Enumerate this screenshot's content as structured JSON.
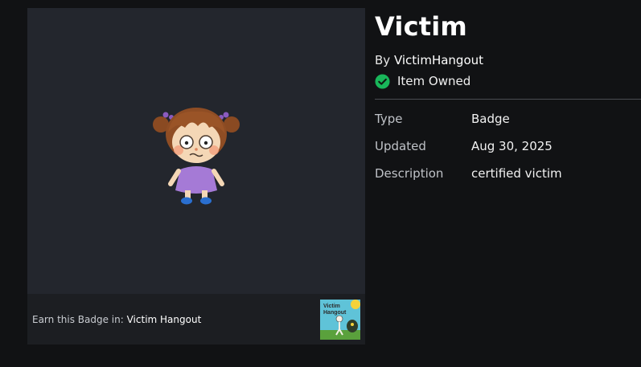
{
  "badge": {
    "title": "Victim",
    "creator_prefix": "By ",
    "creator_name": "VictimHangout",
    "owned_label": "Item Owned",
    "owned_icon": "check-circle-icon",
    "image_icon": "knitted-doll-icon"
  },
  "details": [
    {
      "label": "Type",
      "value": "Badge"
    },
    {
      "label": "Updated",
      "value": "Aug 30, 2025"
    },
    {
      "label": "Description",
      "value": "certified victim"
    }
  ],
  "earn": {
    "prefix": "Earn this Badge in: ",
    "game_name": "Victim Hangout",
    "thumb_text_line1": "Victim",
    "thumb_text_line2": "Hangout",
    "thumb_icon": "game-thumbnail-icon"
  },
  "colors": {
    "background": "#111214",
    "panel": "#23262d",
    "owned_green": "#19b65a",
    "divider": "#4a4c52"
  }
}
